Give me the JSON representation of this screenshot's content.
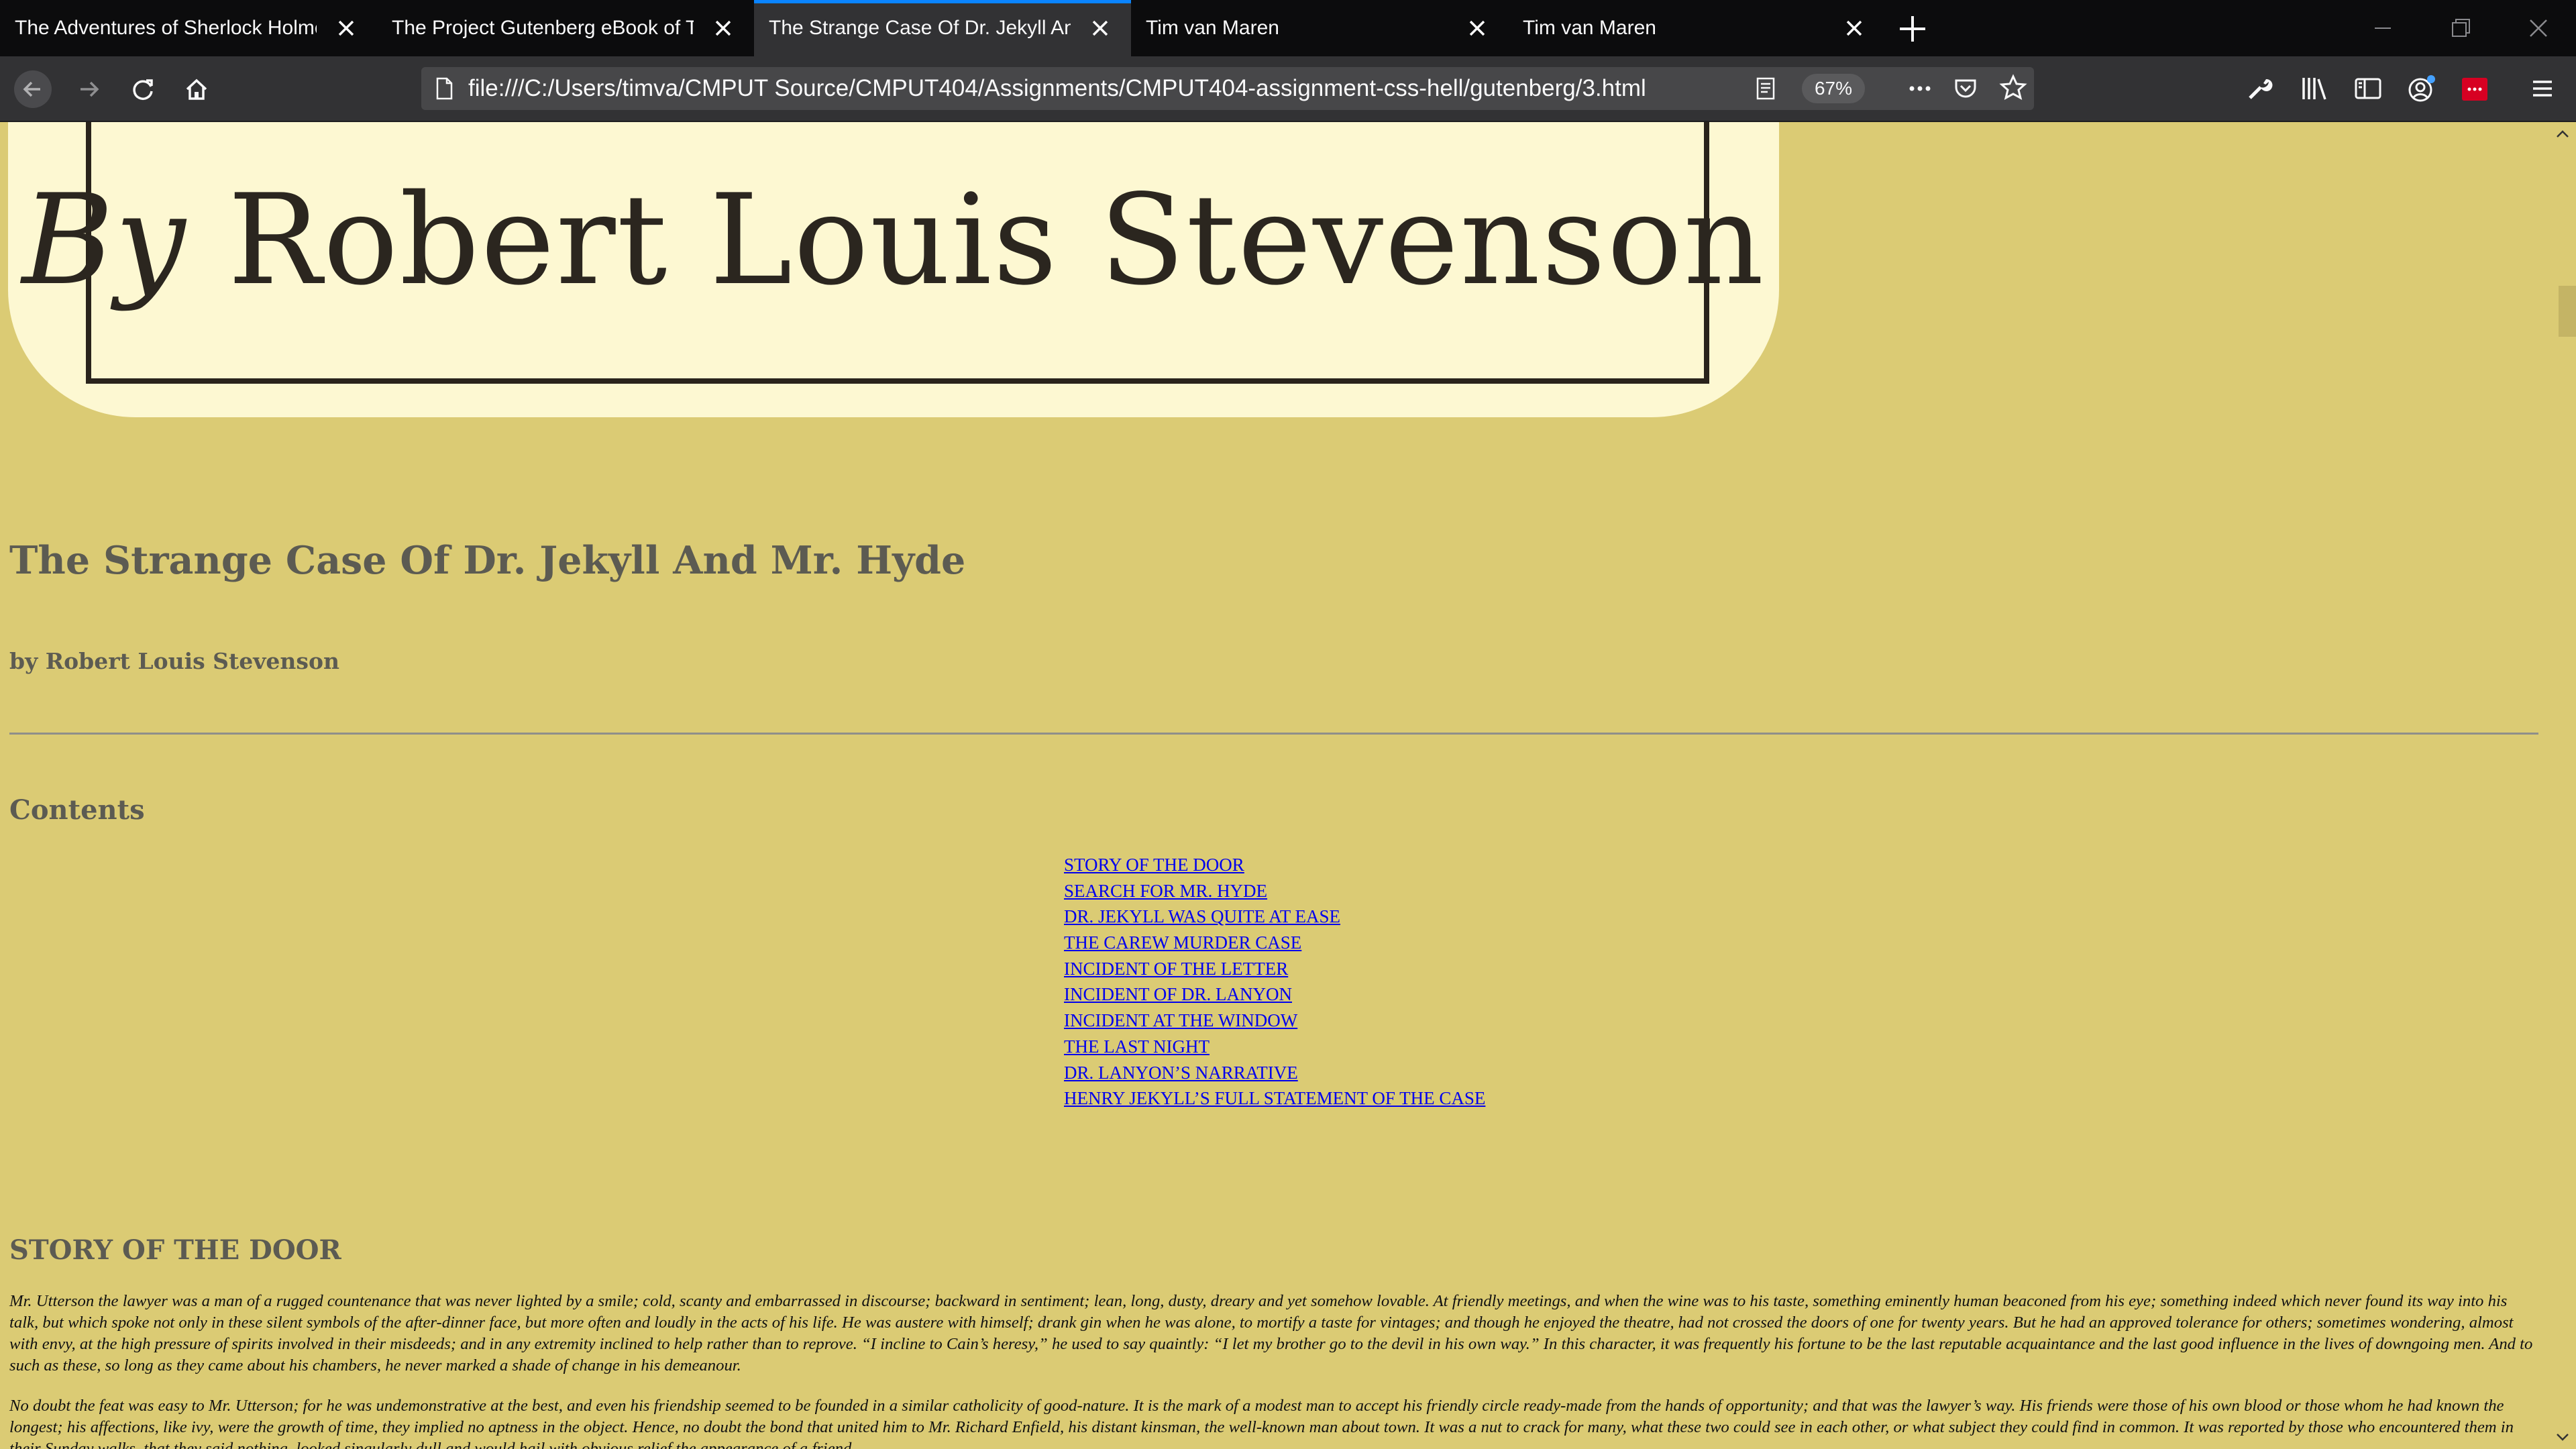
{
  "browser": {
    "tabs": [
      {
        "title": "The Adventures of Sherlock Holmes",
        "active": false
      },
      {
        "title": "The Project Gutenberg eBook of The",
        "active": false
      },
      {
        "title": "The Strange Case Of Dr. Jekyll And Mr. Hyde",
        "active": true
      },
      {
        "title": "Tim van Maren",
        "active": false
      },
      {
        "title": "Tim van Maren",
        "active": false
      }
    ],
    "url": "file:///C:/Users/timva/CMPUT Source/CMPUT404/Assignments/CMPUT404-assignment-css-hell/gutenberg/3.html",
    "zoom": "67%",
    "accent_color": "#0a84ff",
    "icons": [
      "back-icon",
      "forward-icon",
      "reload-icon",
      "home-icon",
      "page-icon",
      "reader-view-icon",
      "more-icon",
      "pocket-icon",
      "bookmark-star-icon",
      "wrench-icon",
      "library-icon",
      "sidebar-icon",
      "account-icon",
      "extension-icon",
      "menu-icon",
      "new-tab-icon",
      "minimize-icon",
      "restore-icon",
      "close-window-icon"
    ]
  },
  "page": {
    "background_color": "#dbcb74",
    "cover": {
      "by": "By",
      "author": "Robert Louis Stevenson"
    },
    "title": "The Strange Case Of Dr. Jekyll And Mr. Hyde",
    "author_line": "by Robert Louis Stevenson",
    "contents_heading": "Contents",
    "toc": [
      "STORY OF THE DOOR",
      "SEARCH FOR MR. HYDE",
      "DR. JEKYLL WAS QUITE AT EASE",
      "THE CAREW MURDER CASE",
      "INCIDENT OF THE LETTER",
      "INCIDENT OF DR. LANYON",
      "INCIDENT AT THE WINDOW",
      "THE LAST NIGHT",
      "DR. LANYON’S NARRATIVE",
      "HENRY JEKYLL’S FULL STATEMENT OF THE CASE"
    ],
    "chapter_heading": "STORY OF THE DOOR",
    "paragraphs": [
      "Mr. Utterson the lawyer was a man of a rugged countenance that was never lighted by a smile; cold, scanty and embarrassed in discourse; backward in sentiment; lean, long, dusty, dreary and yet somehow lovable. At friendly meetings, and when the wine was to his taste, something eminently human beaconed from his eye; something indeed which never found its way into his talk, but which spoke not only in these silent symbols of the after-dinner face, but more often and loudly in the acts of his life. He was austere with himself; drank gin when he was alone, to mortify a taste for vintages; and though he enjoyed the theatre, had not crossed the doors of one for twenty years. But he had an approved tolerance for others; sometimes wondering, almost with envy, at the high pressure of spirits involved in their misdeeds; and in any extremity inclined to help rather than to reprove. “I incline to Cain’s heresy,” he used to say quaintly: “I let my brother go to the devil in his own way.” In this character, it was frequently his fortune to be the last reputable acquaintance and the last good influence in the lives of downgoing men. And to such as these, so long as they came about his chambers, he never marked a shade of change in his demeanour.",
      "No doubt the feat was easy to Mr. Utterson; for he was undemonstrative at the best, and even his friendship seemed to be founded in a similar catholicity of good-nature. It is the mark of a modest man to accept his friendly circle ready-made from the hands of opportunity; and that was the lawyer’s way. His friends were those of his own blood or those whom he had known the longest; his affections, like ivy, were the growth of time, they implied no aptness in the object. Hence, no doubt the bond that united him to Mr. Richard Enfield, his distant kinsman, the well-known man about town. It was a nut to crack for many, what these two could see in each other, or what subject they could find in common. It was reported by those who encountered them in their Sunday walks, that they said nothing, looked singularly dull and would hail with obvious relief the appearance of a friend."
    ]
  }
}
